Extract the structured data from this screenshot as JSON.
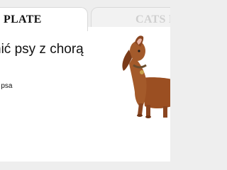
{
  "tabs": [
    {
      "label": "PLATE",
      "active": true
    },
    {
      "label": "CATS P",
      "active": false
    }
  ],
  "hero": {
    "heading": "nić psy z chorą",
    "link_text": "a psa",
    "image_icon": "dachshund-dog-barking"
  },
  "colors": {
    "background": "#eeeeee",
    "panel": "#ffffff",
    "text": "#111111",
    "inactive_tab_text": "#cfcfcf",
    "dog_coat": "#a0522d"
  }
}
